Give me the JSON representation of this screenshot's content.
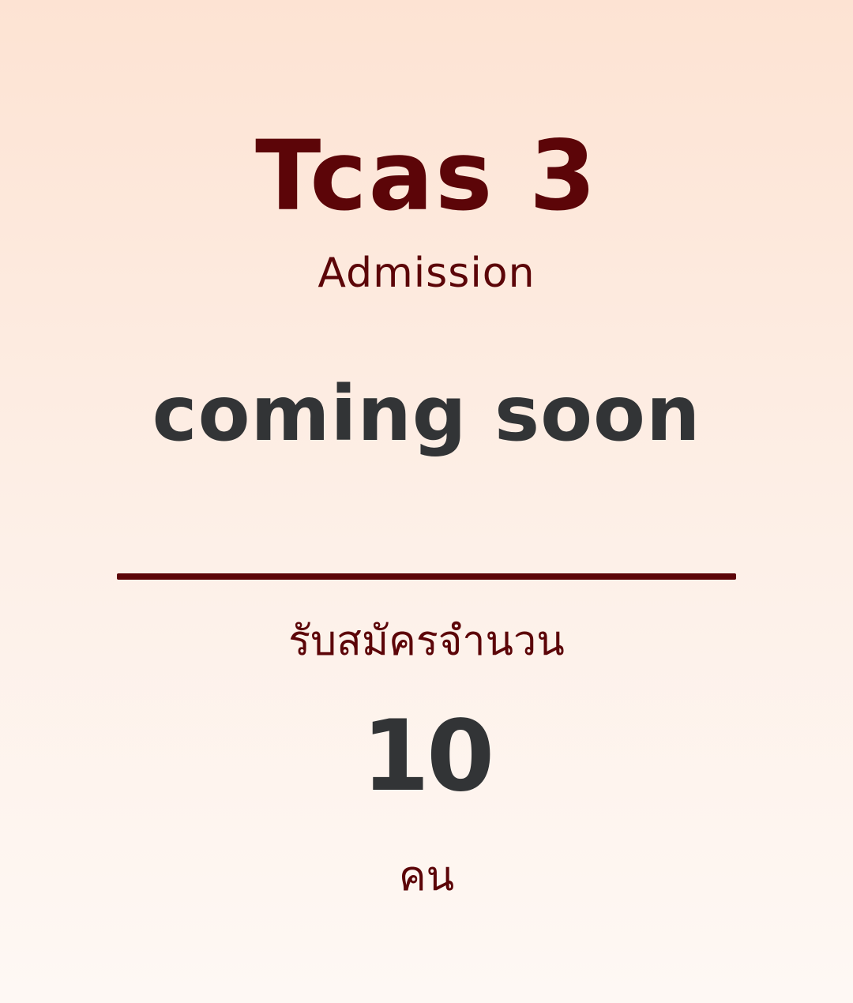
{
  "colors": {
    "accent": "#5c0508",
    "dark_text": "#323436",
    "background_top": "#fde3d3",
    "background_bottom": "#fef8f4"
  },
  "header": {
    "title": "Tcas 3",
    "subtitle": "Admission"
  },
  "headline": "coming soon",
  "quota": {
    "label": "รับสมัครจำนวน",
    "count": "10",
    "unit": "คน"
  }
}
